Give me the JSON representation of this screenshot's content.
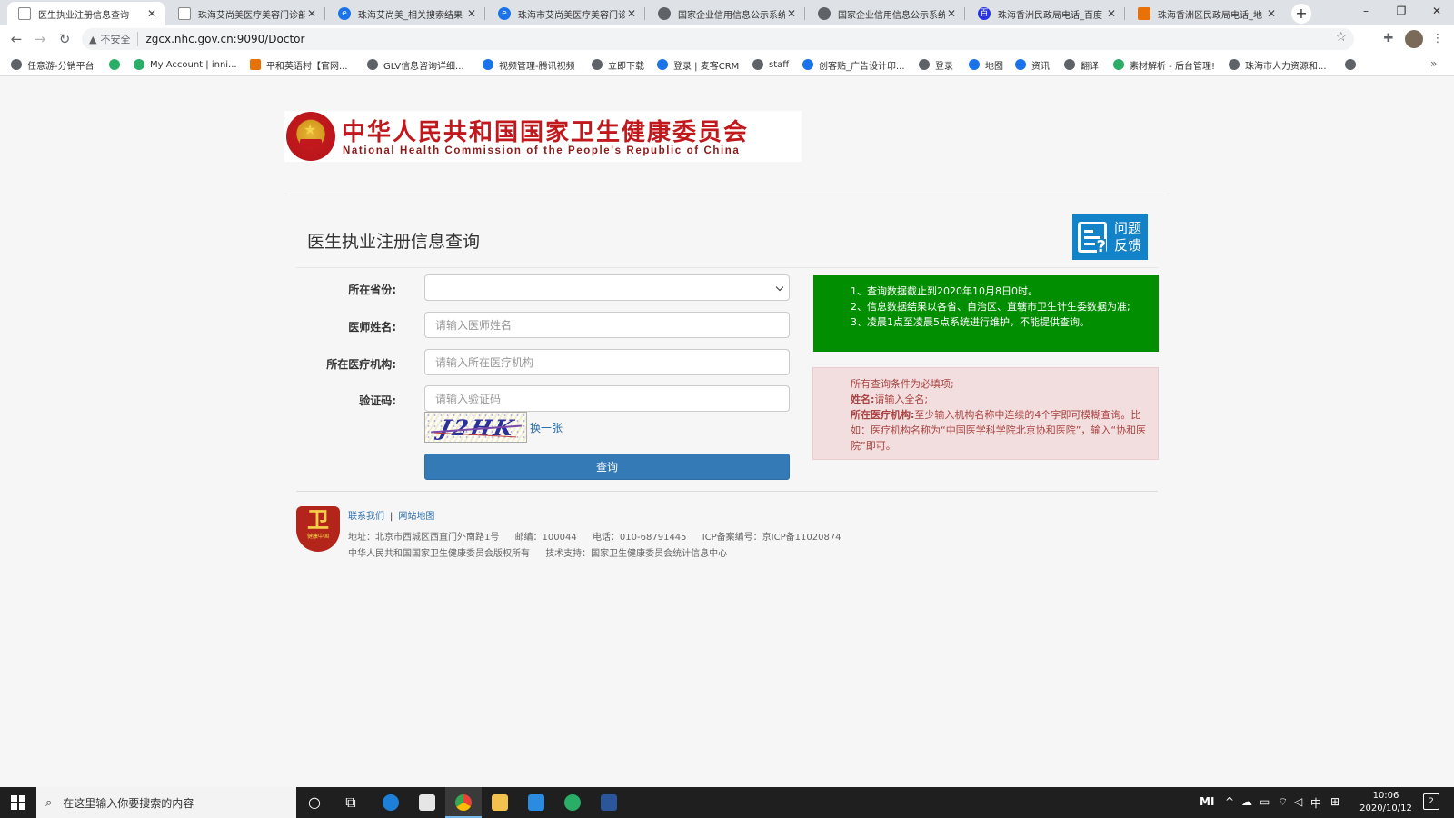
{
  "browser": {
    "tabs": [
      {
        "title": "医生执业注册信息查询",
        "icon": "doc-icon",
        "active": true
      },
      {
        "title": "珠海艾尚美医疗美容门诊部",
        "icon": "doc-icon",
        "active": false
      },
      {
        "title": "珠海艾尚美_相关搜索结果",
        "icon": "ie-icon",
        "active": false
      },
      {
        "title": "珠海市艾尚美医疗美容门诊",
        "icon": "ie-icon",
        "active": false
      },
      {
        "title": "国家企业信用信息公示系统",
        "icon": "globe-icon",
        "active": false
      },
      {
        "title": "国家企业信用信息公示系统",
        "icon": "globe-icon",
        "active": false
      },
      {
        "title": "珠海香洲民政局电话_百度",
        "icon": "baidu-icon",
        "active": false
      },
      {
        "title": "珠海香洲区民政局电话_地",
        "icon": "chart-icon",
        "active": false
      }
    ],
    "new_tab": "+",
    "window_controls": {
      "minimize": "–",
      "restore": "❐",
      "close": "✕"
    },
    "security_label": "不安全",
    "url": "zgcx.nhc.gov.cn:9090/Doctor",
    "bookmarks": [
      {
        "label": "任意游-分销平台",
        "icon": "globe-icon"
      },
      {
        "label": "",
        "icon": "wechat-icon"
      },
      {
        "label": "My Account | inni...",
        "icon": "leaf-icon"
      },
      {
        "label": "平和英语村【官网...",
        "icon": "page-icon"
      },
      {
        "label": "GLV信息咨询详细...",
        "icon": "globe-icon"
      },
      {
        "label": "视频管理-腾讯视频",
        "icon": "play-icon"
      },
      {
        "label": "立即下载",
        "icon": "globe-icon"
      },
      {
        "label": "登录 | 麦客CRM",
        "icon": "crm-icon"
      },
      {
        "label": "staff",
        "icon": "globe-icon"
      },
      {
        "label": "创客贴_广告设计印...",
        "icon": "brush-icon"
      },
      {
        "label": "登录",
        "icon": "ball-icon"
      },
      {
        "label": "地图",
        "icon": "map-pin-icon"
      },
      {
        "label": "资讯",
        "icon": "news-icon"
      },
      {
        "label": "翻译",
        "icon": "globe-icon"
      },
      {
        "label": "素材解析 - 后台管理!",
        "icon": "v-icon"
      },
      {
        "label": "珠海市人力资源和...",
        "icon": "globe-icon"
      },
      {
        "label": "",
        "icon": "globe-icon"
      }
    ],
    "bookmarks_more": "»"
  },
  "banner": {
    "title_cn": "中华人民共和国国家卫生健康委员会",
    "title_en": "National Health Commission of the People's Republic of China"
  },
  "page": {
    "title": "医生执业注册信息查询",
    "feedback": "问题反馈"
  },
  "form": {
    "province_label": "所在省份:",
    "province_value": "",
    "name_label": "医师姓名:",
    "name_placeholder": "请输入医师姓名",
    "institution_label": "所在医疗机构:",
    "institution_placeholder": "请输入所在医疗机构",
    "captcha_label": "验证码:",
    "captcha_placeholder": "请输入验证码",
    "captcha_text": "J2HK",
    "refresh_label": "换一张",
    "submit_label": "查询"
  },
  "notice_green": [
    "1、查询数据截止到2020年10月8日0时。",
    "2、信息数据结果以各省、自治区、直辖市卫生计生委数据为准;",
    "3、凌晨1点至凌晨5点系统进行维护，不能提供查询。"
  ],
  "notice_red": {
    "line1": "所有查询条件为必填项;",
    "name_key": "姓名:",
    "name_val": "请输入全名;",
    "inst_key": "所在医疗机构:",
    "inst_val": "至少输入机构名称中连续的4个字即可模糊查询。比如：医疗机构名称为“中国医学科学院北京协和医院”，输入“协和医院”即可。"
  },
  "footer": {
    "logo_text": "卫",
    "logo_sub": "健康中国",
    "contact": "联系我们",
    "sitemap": "网站地图",
    "address": "地址：北京市西城区西直门外南路1号",
    "postcode": "邮编：100044",
    "phone": "电话：010-68791445",
    "icp": "ICP备案编号：京ICP备11020874",
    "copyright": "中华人民共和国国家卫生健康委员会版权所有",
    "support": "技术支持：国家卫生健康委员会统计信息中心"
  },
  "taskbar": {
    "search_placeholder": "在这里输入你要搜索的内容",
    "tray_ime": "中",
    "time": "10:06",
    "date": "2020/10/12",
    "notifications": "2"
  }
}
